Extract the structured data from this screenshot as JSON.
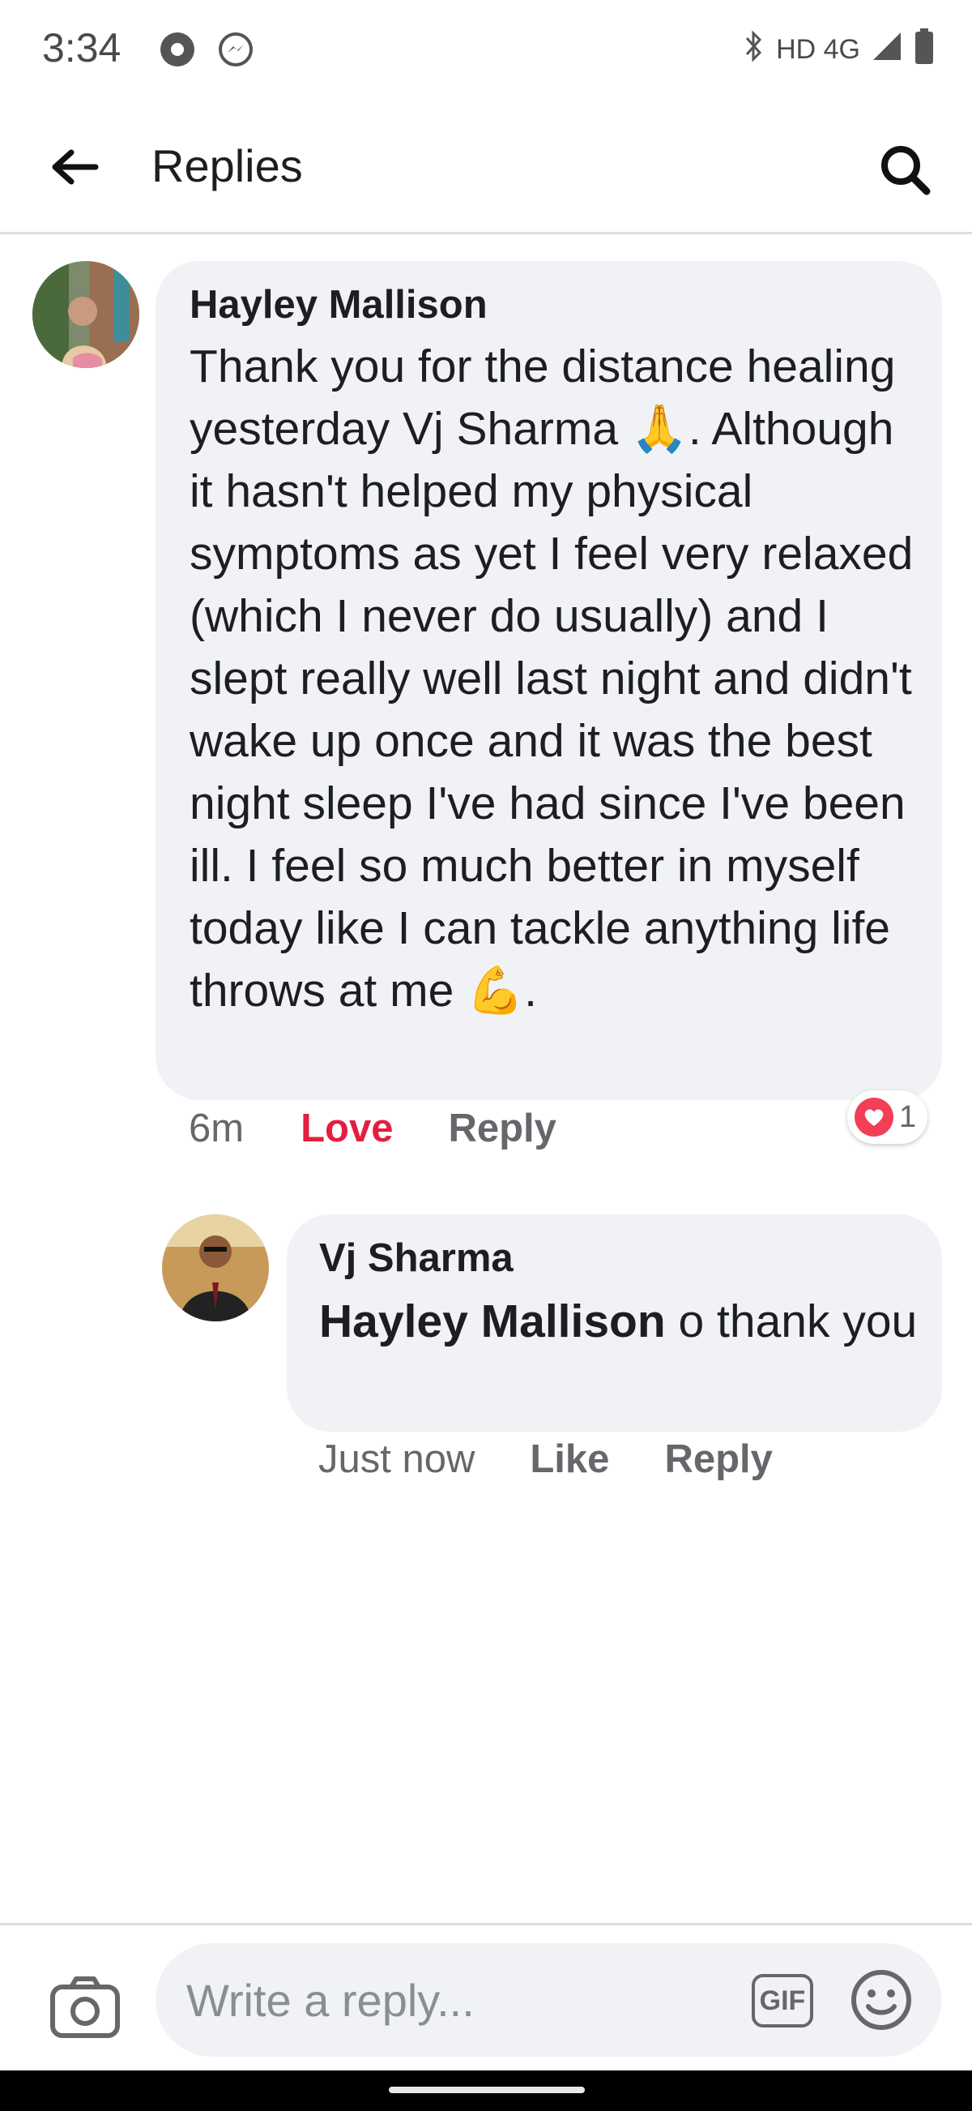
{
  "status_bar": {
    "time": "3:34",
    "network": "HD 4G"
  },
  "header": {
    "title": "Replies",
    "back_icon": "arrow-left-icon",
    "search_icon": "search-icon"
  },
  "comments": [
    {
      "author": "Hayley Mallison",
      "text": "Thank you for the distance healing yesterday Vj Sharma 🙏. Although it hasn't helped my physical symptoms as yet I feel very relaxed (which I never do usually) and I slept really well last night and didn't wake up once and it was the best night sleep I've had since I've been ill. I feel so much better in myself today like I can tackle anything life throws at me 💪.",
      "time": "6m",
      "react_label": "Love",
      "reply_label": "Reply",
      "reaction_count": "1",
      "react_color": "#e41e3f"
    },
    {
      "author": "Vj Sharma",
      "mention": "Hayley Mallison",
      "text": " o thank you",
      "time": "Just now",
      "react_label": "Like",
      "reply_label": "Reply"
    }
  ],
  "composer": {
    "placeholder": "Write a reply...",
    "gif_label": "GIF"
  }
}
